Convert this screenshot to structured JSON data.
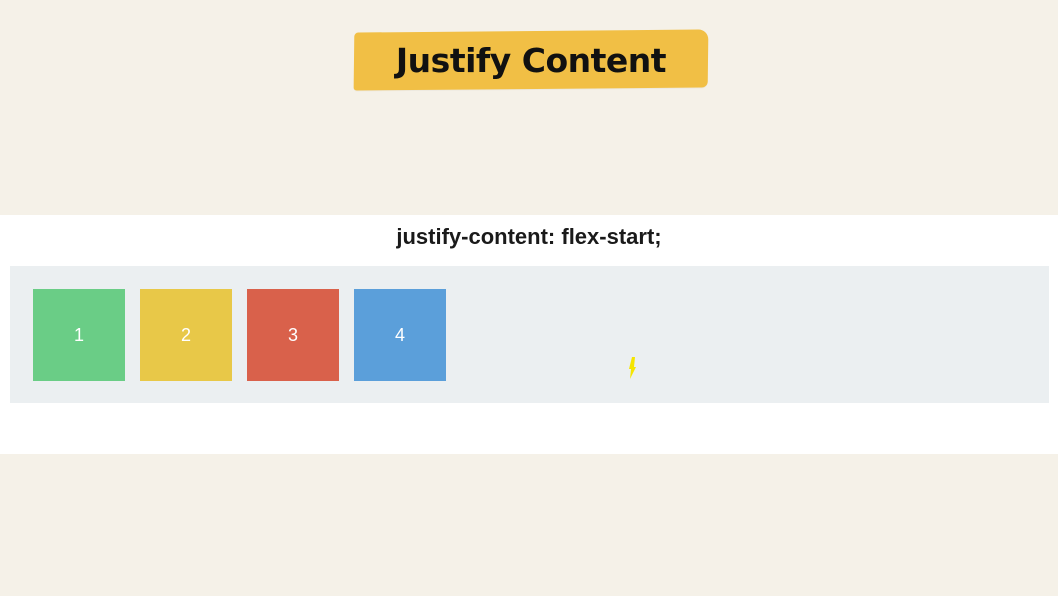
{
  "header": {
    "title": "Justify Content",
    "banner_color": "#f1bf45"
  },
  "demo": {
    "label": "justify-content: flex-start;",
    "container_color": "#ebeff1",
    "items": [
      {
        "label": "1",
        "color": "#6acd86"
      },
      {
        "label": "2",
        "color": "#e8c848"
      },
      {
        "label": "3",
        "color": "#d9614b"
      },
      {
        "label": "4",
        "color": "#5b9fda"
      }
    ]
  },
  "pointer": {
    "icon": "pointer-cursor-icon",
    "color": "#f5e500"
  }
}
